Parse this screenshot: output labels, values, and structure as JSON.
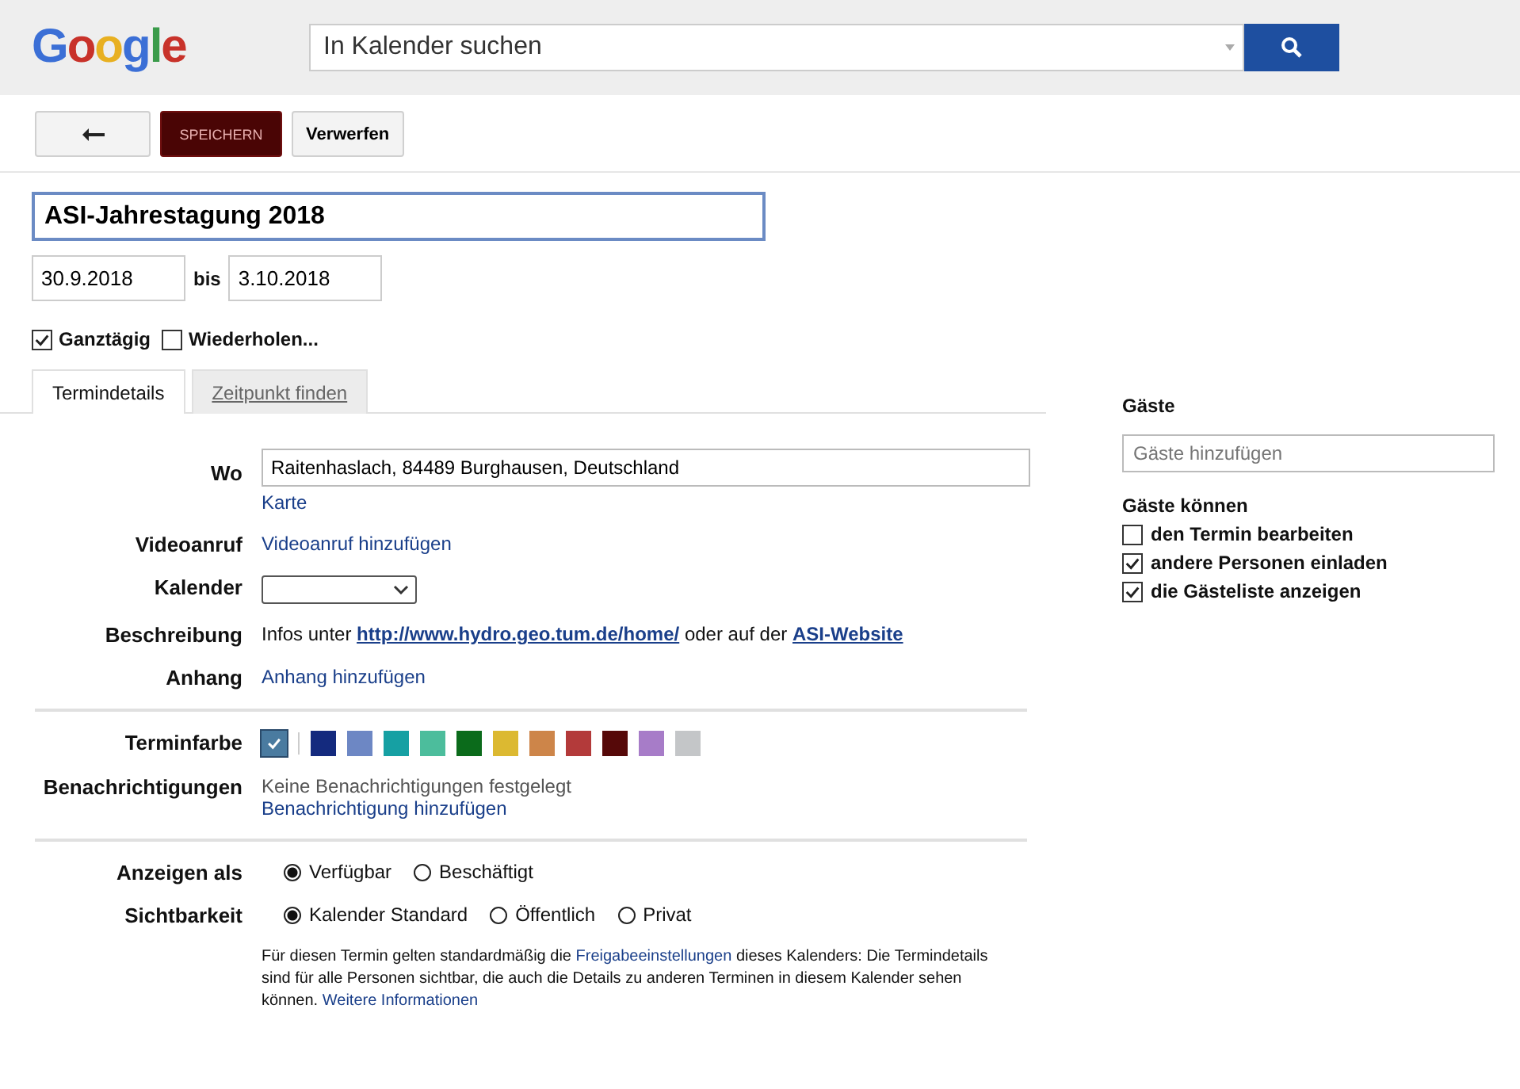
{
  "header": {
    "logo": "Google",
    "search": {
      "placeholder": "In Kalender suchen"
    }
  },
  "toolbar": {
    "buttons": [
      {
        "kind": "back"
      },
      {
        "kind": "primary",
        "label": "SPEICHERN"
      },
      {
        "kind": "plain",
        "label": "Verwerfen"
      }
    ]
  },
  "event": {
    "title": "ASI-Jahrestagung 2018",
    "start_date": "30.9.2018",
    "between": "bis",
    "end_date": "3.10.2018"
  },
  "options": [
    {
      "label": "Ganztägig",
      "checked": true
    },
    {
      "label": "Wiederholen...",
      "checked": false
    }
  ],
  "tabs": [
    {
      "label": "Termindetails",
      "selected": true
    },
    {
      "label": "Zeitpunkt finden",
      "selected": false
    }
  ],
  "details": [
    {
      "kind": "location",
      "label": "Wo",
      "value": "Raitenhaslach, 84489 Burghausen, Deutschland",
      "link": "Karte"
    },
    {
      "kind": "link",
      "label": "Videoanruf",
      "link": "Videoanruf hinzufügen"
    },
    {
      "kind": "select",
      "label": "Kalender"
    },
    {
      "kind": "rich",
      "label": "Beschreibung",
      "parts": [
        {
          "kind": "text",
          "text": "Infos unter "
        },
        {
          "kind": "url",
          "text": "http://www.hydro.geo.tum.de/home/"
        },
        {
          "kind": "text",
          "text": " oder auf der "
        },
        {
          "kind": "url",
          "text": "ASI-Website"
        }
      ]
    },
    {
      "kind": "link",
      "label": "Anhang",
      "link": "Anhang hinzufügen"
    },
    {
      "kind": "divider"
    },
    {
      "kind": "colors",
      "label": "Terminfarbe",
      "swatches": [
        {
          "color": "#4a7ba0",
          "selected": true
        },
        {
          "color": "#142a7e",
          "selected": false
        },
        {
          "color": "#6d87c4",
          "selected": false
        },
        {
          "color": "#16a0a3",
          "selected": false
        },
        {
          "color": "#4cbd9c",
          "selected": false
        },
        {
          "color": "#0b6b1b",
          "selected": false
        },
        {
          "color": "#dcb931",
          "selected": false
        },
        {
          "color": "#cd8549",
          "selected": false
        },
        {
          "color": "#b33a3a",
          "selected": false
        },
        {
          "color": "#560909",
          "selected": false
        },
        {
          "color": "#a77cc8",
          "selected": false
        },
        {
          "color": "#c4c6c8",
          "selected": false
        }
      ]
    },
    {
      "kind": "notice",
      "label": "Benachrichtigungen",
      "note": "Keine Benachrichtigungen festgelegt",
      "link": "Benachrichtigung hinzufügen"
    },
    {
      "kind": "divider"
    },
    {
      "kind": "radios",
      "label": "Anzeigen als",
      "options": [
        {
          "label": "Verfügbar",
          "selected": true
        },
        {
          "label": "Beschäftigt",
          "selected": false
        }
      ]
    },
    {
      "kind": "radios",
      "label": "Sichtbarkeit",
      "options": [
        {
          "label": "Kalender Standard",
          "selected": true
        },
        {
          "label": "Öffentlich",
          "selected": false
        },
        {
          "label": "Privat",
          "selected": false
        }
      ]
    },
    {
      "kind": "info",
      "parts": [
        {
          "kind": "text",
          "text": "Für diesen Termin gelten standardmäßig die "
        },
        {
          "kind": "link",
          "text": "Freigabeeinstellungen"
        },
        {
          "kind": "text",
          "text": " dieses Kalenders: Die Termindetails sind für alle Personen sichtbar, die auch die Details zu anderen Terminen in diesem Kalender sehen können. "
        },
        {
          "kind": "link",
          "text": "Weitere Informationen"
        }
      ]
    }
  ],
  "guests": {
    "title": "Gäste",
    "field": {
      "placeholder": "Gäste hinzufügen"
    },
    "permissions_title": "Gäste können",
    "permissions": [
      {
        "label": "den Termin bearbeiten",
        "checked": false
      },
      {
        "label": "andere Personen einladen",
        "checked": true
      },
      {
        "label": "die Gästeliste anzeigen",
        "checked": true
      }
    ]
  }
}
